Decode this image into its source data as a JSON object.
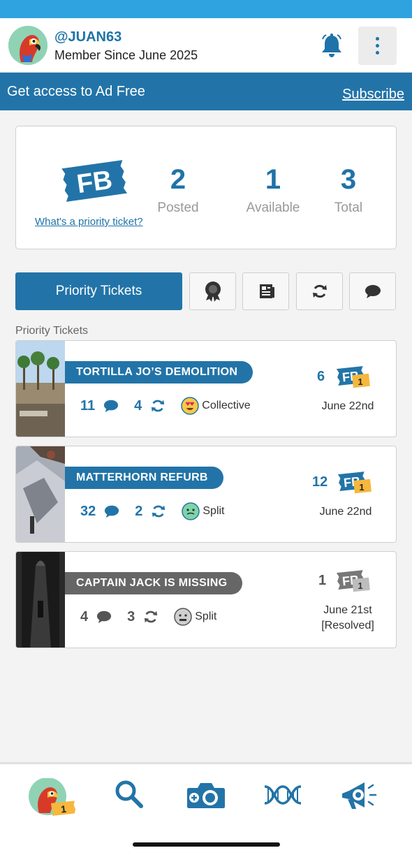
{
  "header": {
    "username": "@JUAN63",
    "member_since": "Member Since June 2025"
  },
  "promo": {
    "text": "Get access to Ad Free",
    "link": "Subscribe"
  },
  "stats": {
    "logo_text": "FB",
    "priority_link": "What's a priority ticket?",
    "items": [
      {
        "value": "2",
        "label": "Posted"
      },
      {
        "value": "1",
        "label": "Available"
      },
      {
        "value": "3",
        "label": "Total"
      }
    ]
  },
  "tabs": {
    "active_label": "Priority Tickets"
  },
  "section_label": "Priority Tickets",
  "tickets": [
    {
      "title": "TORTILLA JO’S DEMOLITION",
      "comments": "11",
      "reposts": "4",
      "tag": "Collective",
      "count": "6",
      "badge": "1",
      "date": "June 22nd",
      "status": "",
      "color": "#2274a8"
    },
    {
      "title": "MATTERHORN REFURB",
      "comments": "32",
      "reposts": "2",
      "tag": "Split",
      "count": "12",
      "badge": "1",
      "date": "June 22nd",
      "status": "",
      "color": "#2274a8"
    },
    {
      "title": "CAPTAIN JACK IS MISSING",
      "comments": "4",
      "reposts": "3",
      "tag": "Split",
      "count": "1",
      "badge": "1",
      "date": "June 21st",
      "status": "[Resolved]",
      "color": "#666666"
    }
  ],
  "bottom_nav": {
    "avatar_badge": "1"
  },
  "colors": {
    "brand_blue": "#2274a8",
    "accent_orange": "#f6b73c",
    "resolved_gray": "#666666"
  }
}
